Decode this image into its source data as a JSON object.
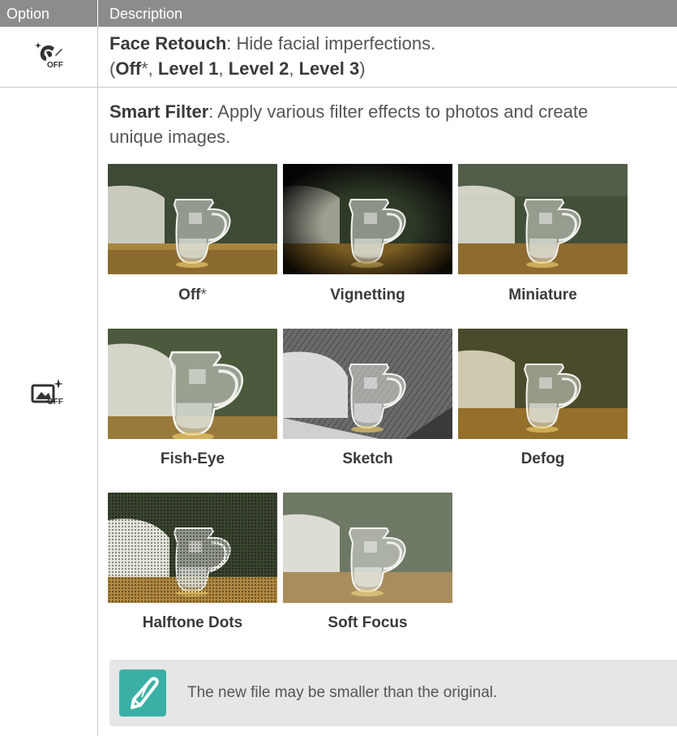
{
  "table": {
    "header": {
      "option": "Option",
      "description": "Description"
    },
    "rows": [
      {
        "icon": "face-retouch-off-icon",
        "title": "Face Retouch",
        "desc": ": Hide facial imperfections.",
        "levels": {
          "open": "(",
          "off": "Off",
          "asterisk": "*",
          "sep": ", ",
          "l1": "Level 1",
          "l2": "Level 2",
          "l3": "Level 3",
          "close": ")"
        }
      },
      {
        "icon": "smart-filter-off-icon",
        "title": "Smart Filter",
        "desc_line1": ": Apply various filter effects to photos and create",
        "desc_line2": "unique images.",
        "filters": [
          {
            "name": "Off",
            "asterisk": "*"
          },
          {
            "name": "Vignetting"
          },
          {
            "name": "Miniature"
          },
          {
            "name": "Fish-Eye"
          },
          {
            "name": "Sketch"
          },
          {
            "name": "Defog"
          },
          {
            "name": "Halftone Dots"
          },
          {
            "name": "Soft Focus"
          }
        ],
        "note": {
          "icon": "pencil-note-icon",
          "text": "The new file may be smaller than the original."
        }
      }
    ]
  },
  "colors": {
    "header_bg": "#8c8c8c",
    "note_bg": "#e6e6e6",
    "note_icon_bg": "#3ab0a5"
  }
}
